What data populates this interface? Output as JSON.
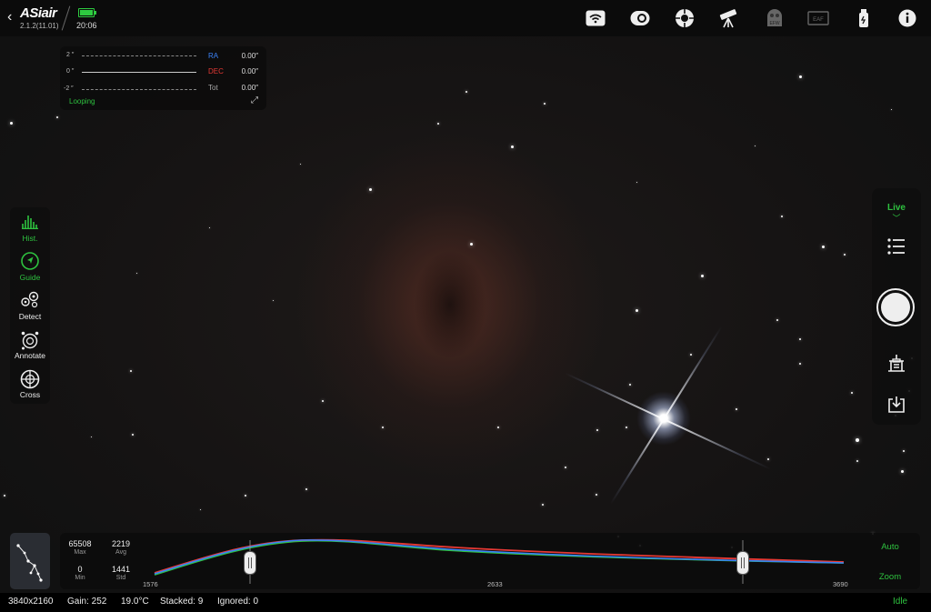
{
  "header": {
    "app_name": "ASiair",
    "version": "2.1.2(11.01)",
    "time": "20:06",
    "icons": [
      "back-chevron-icon",
      "battery-icon",
      "wifi-icon",
      "camera-icon",
      "guide-camera-icon",
      "telescope-mount-icon",
      "filter-wheel-icon",
      "eaf-focuser-icon",
      "usb-icon",
      "info-icon"
    ],
    "efw_label": "EFW",
    "eaf_label": "EAF"
  },
  "guiding": {
    "axis_top": "2 ″",
    "axis_mid": "0 ″",
    "axis_bottom": "-2 ″",
    "ra_label": "RA",
    "ra_value": "0.00″",
    "dec_label": "DEC",
    "dec_value": "0.00″",
    "tot_label": "Tot",
    "tot_value": "0.00″",
    "status": "Looping",
    "colors": {
      "ra": "#3b82f6",
      "dec": "#e53935",
      "status": "#2ec13f"
    }
  },
  "left_tools": [
    {
      "label": "Hist.",
      "icon": "histogram-icon",
      "active": true
    },
    {
      "label": "Guide",
      "icon": "guide-arrow-icon",
      "active": true
    },
    {
      "label": "Detect",
      "icon": "detect-stars-icon",
      "active": false
    },
    {
      "label": "Annotate",
      "icon": "annotate-icon",
      "active": false
    },
    {
      "label": "Cross",
      "icon": "crosshair-icon",
      "active": false
    }
  ],
  "right_tools": {
    "mode_label": "Live",
    "icons": [
      "list-icon",
      "shutter-button",
      "stack-settings-icon",
      "save-icon"
    ]
  },
  "histogram": {
    "max_value": "65508",
    "max_label": "Max",
    "avg_value": "2219",
    "avg_label": "Avg",
    "min_value": "0",
    "min_label": "Min",
    "std_value": "1441",
    "std_label": "Std",
    "x_left": "1576",
    "x_mid": "2633",
    "x_right": "3690",
    "auto_label": "Auto",
    "zoom_label": "Zoom",
    "series_colors": {
      "red": "#e53935",
      "green": "#2ec13f",
      "blue": "#3b82f6"
    }
  },
  "status_bar": {
    "resolution": "3840x2160",
    "gain": "Gain: 252",
    "temperature": "19.0°C",
    "stacked": "Stacked: 9",
    "ignored": "Ignored: 0",
    "state": "Idle"
  }
}
